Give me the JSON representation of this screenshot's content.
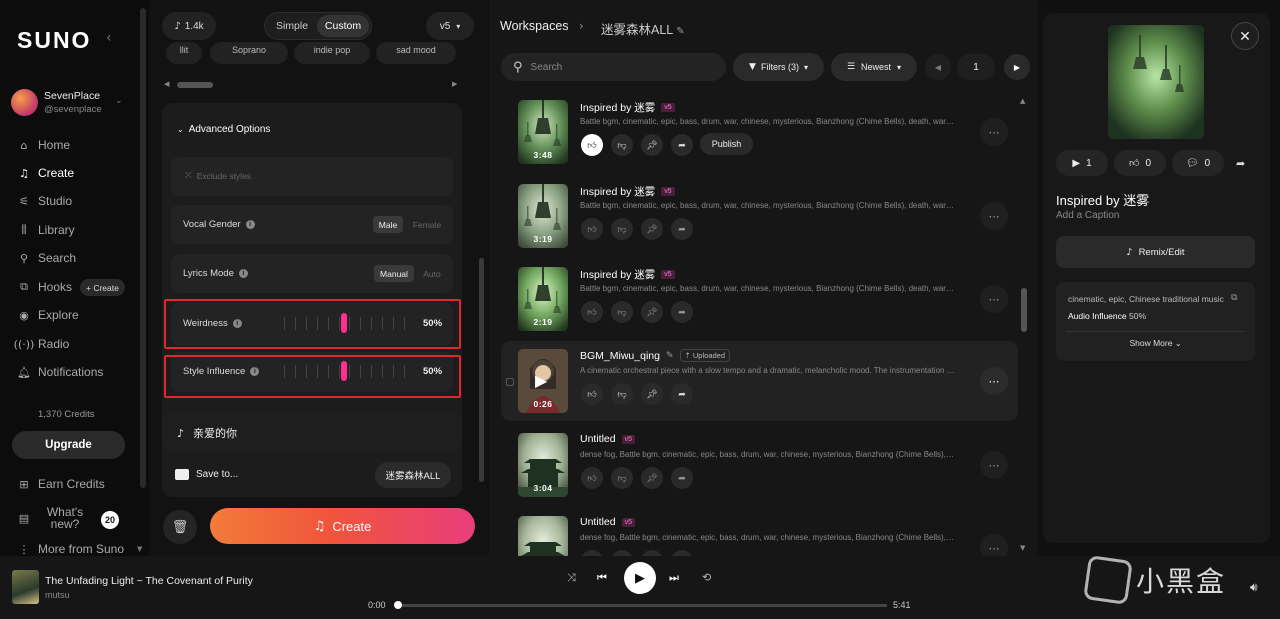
{
  "sidebar": {
    "logo": "SUNO",
    "user": {
      "name": "SevenPlace",
      "handle": "@sevenplace"
    },
    "nav": [
      {
        "label": "Home",
        "icon": "home-icon"
      },
      {
        "label": "Create",
        "icon": "music-note-icon"
      },
      {
        "label": "Studio",
        "icon": "studio-icon"
      },
      {
        "label": "Library",
        "icon": "library-icon"
      },
      {
        "label": "Search",
        "icon": "search-icon"
      },
      {
        "label": "Hooks",
        "icon": "hooks-icon"
      },
      {
        "label": "Explore",
        "icon": "compass-icon"
      },
      {
        "label": "Radio",
        "icon": "radio-icon"
      },
      {
        "label": "Notifications",
        "icon": "bell-icon"
      }
    ],
    "hooks_create": "+ Create",
    "credits": "1,370 Credits",
    "upgrade": "Upgrade",
    "earn_credits": "Earn Credits",
    "whats_new": "What's new?",
    "whats_new_count": "20",
    "more_from_suno": "More from Suno"
  },
  "create_panel": {
    "credits_pill": "1.4k",
    "mode_simple": "Simple",
    "mode_custom": "Custom",
    "model": "v5",
    "style_chips": [
      "Soprano",
      "indie pop",
      "sad mood"
    ],
    "advanced_options": "Advanced Options",
    "exclude_styles_placeholder": "Exclude styles",
    "vocal_gender": {
      "label": "Vocal Gender",
      "options": [
        "Male",
        "Female"
      ],
      "selected": "Male"
    },
    "lyrics_mode": {
      "label": "Lyrics Mode",
      "options": [
        "Manual",
        "Auto"
      ],
      "selected": "Manual"
    },
    "weirdness": {
      "label": "Weirdness",
      "value": 50,
      "display": "50%"
    },
    "style_influence": {
      "label": "Style Influence",
      "value": 50,
      "display": "50%"
    },
    "song_title": "亲爱的你",
    "save_to_label": "Save to...",
    "save_to_value": "迷雾森林ALL",
    "create_button": "Create"
  },
  "workspace": {
    "breadcrumb_root": "Workspaces",
    "breadcrumb_current": "迷雾森林ALL",
    "search_placeholder": "Search",
    "filters_label": "Filters (3)",
    "sort_label": "Newest",
    "page": "1",
    "publish_label": "Publish",
    "uploaded_label": "Uploaded",
    "tracks": [
      {
        "title": "Inspired by 迷雾",
        "badge": "v5",
        "duration": "3:48",
        "desc": "Battle bgm, cinematic, epic, bass, drum, war, chinese, mysterious, Bianzhong (Chime Bells), death, warfare, horror",
        "liked": true,
        "art": "bell-green"
      },
      {
        "title": "Inspired by 迷雾",
        "badge": "v5",
        "duration": "3:19",
        "desc": "Battle bgm, cinematic, epic, bass, drum, war, chinese, mysterious, Bianzhong (Chime Bells), death, warfare, horror",
        "liked": false,
        "art": "bell-pale"
      },
      {
        "title": "Inspired by 迷雾",
        "badge": "v5",
        "duration": "2:19",
        "desc": "Battle bgm, cinematic, epic, bass, drum, war, chinese, mysterious, Bianzhong (Chime Bells), death, warfare, horror",
        "liked": false,
        "art": "bell-glow"
      },
      {
        "title": "BGM_Miwu_qing",
        "badge": "",
        "duration": "0:26",
        "desc": "A cinematic orchestral piece with a slow tempo and a dramatic, melancholic mood. The instrumentation features strings",
        "liked": false,
        "art": "portrait"
      },
      {
        "title": "Untitled",
        "badge": "v5",
        "duration": "3:04",
        "desc": "dense fog, Battle bgm, cinematic, epic, bass, drum, war, chinese, mysterious, Bianzhong (Chime Bells), death",
        "liked": false,
        "art": "pagoda"
      },
      {
        "title": "Untitled",
        "badge": "v5",
        "duration": "",
        "desc": "dense fog, Battle bgm, cinematic, epic, bass, drum, war, chinese, mysterious, Bianzhong (Chime Bells), death",
        "liked": false,
        "art": "pagoda-2"
      }
    ]
  },
  "detail_panel": {
    "plays": "1",
    "likes": "0",
    "comments": "0",
    "title": "Inspired by 迷雾",
    "caption": "Add a Caption",
    "remix_label": "Remix/Edit",
    "style_tags": "cinematic, epic, Chinese traditional music",
    "audio_influence_label": "Audio Influence",
    "audio_influence_value": "50%",
    "show_more": "Show More"
  },
  "player": {
    "title": "The Unfading Light ~ The Covenant of Purity",
    "artist": "mutsu",
    "elapsed": "0:00",
    "total": "5:41",
    "progress": 0.0
  },
  "watermark": "小黑盒",
  "colors": {
    "accent_pink": "#ff2e92",
    "create_gradient_start": "#f27b3a",
    "create_gradient_end": "#e93d7b",
    "highlight_box": "#e0262f"
  }
}
